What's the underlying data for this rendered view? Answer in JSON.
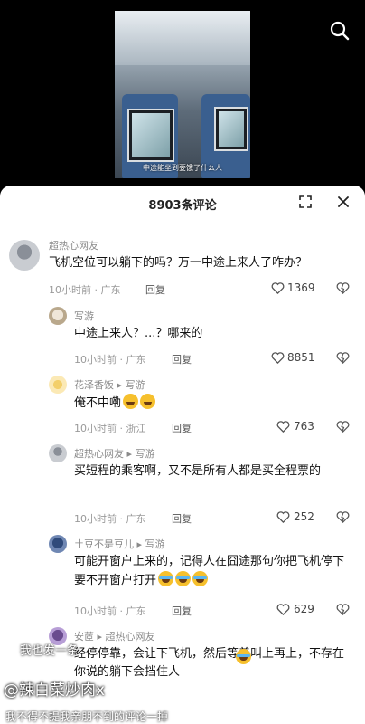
{
  "video": {
    "caption": "中途能坐到要饿了什么人",
    "search_icon": "search-icon"
  },
  "comments_panel": {
    "title": "8903条评论",
    "close_icon": "close-icon",
    "expand_icon": "expand-icon"
  },
  "comments": [
    {
      "user": "超热心网友",
      "text": "飞机空位可以躺下的吗？万一中途上来人了咋办？",
      "time": "10小时前 · 广东",
      "reply": "回复",
      "likes": "1369"
    },
    {
      "user": "写游",
      "text": "中途上来人？...？哪来的",
      "time": "10小时前 · 广东",
      "reply": "回复",
      "likes": "8851"
    },
    {
      "user": "花泽香饭 ▸ 写游",
      "text": "俺不中嘞",
      "time": "10小时前 · 浙江",
      "reply": "回复",
      "likes": "763"
    },
    {
      "user": "超热心网友 ▸ 写游",
      "text": "买短程的乘客啊，又不是所有人都是买全程票的",
      "time": "10小时前 · 广东",
      "reply": "回复",
      "likes": "252"
    },
    {
      "user": "土豆不是豆儿 ▸ 写游",
      "text": "可能开窗户上来的，记得人在囧途那句你把飞机停下要不开窗户打开",
      "time": "10小时前 · 广东",
      "reply": "回复",
      "likes": "629"
    },
    {
      "user": "安茝 ▸ 超热心网友",
      "text": "经停停靠，会让下飞机，然后等着叫上再上，不存在你说的躺下会挡住人",
      "time": "",
      "reply": "",
      "likes": ""
    }
  ],
  "overlay": {
    "danmaku": "我也发一条",
    "watermark": "@辣白菜炒肉x",
    "bottom_text": "我不得不提我亲朋不到的评论一掉"
  }
}
